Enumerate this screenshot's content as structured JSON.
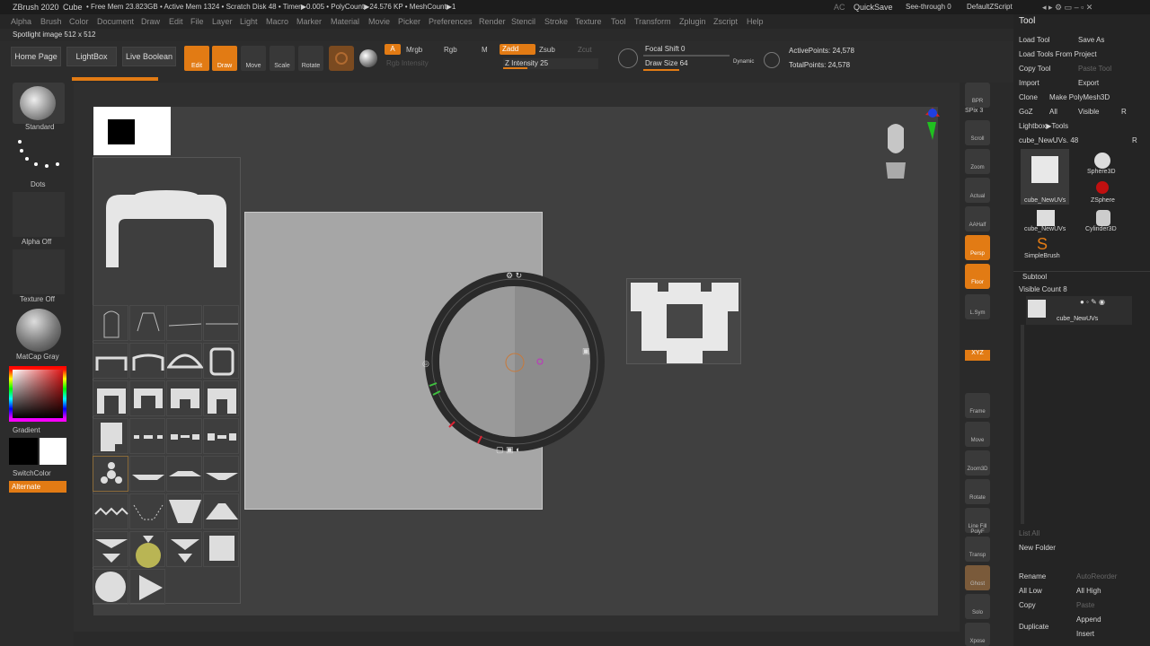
{
  "titlebar": {
    "app": "ZBrush 2020",
    "doc": "Cube",
    "stats": "• Free Mem 23.823GB • Active Mem 1324 • Scratch Disk 48 • Timer▶0.005 • PolyCount▶24.576 KP • MeshCount▶1",
    "ac": "AC",
    "quicksave": "QuickSave",
    "seethrough": "See-through 0",
    "script": "DefaultZScript"
  },
  "menu": [
    "Alpha",
    "Brush",
    "Color",
    "Document",
    "Draw",
    "Edit",
    "File",
    "Layer",
    "Light",
    "Macro",
    "Marker",
    "Material",
    "Movie",
    "Picker",
    "Preferences",
    "Render",
    "Stencil",
    "Stroke",
    "Texture",
    "Tool",
    "Transform",
    "Zplugin",
    "Zscript",
    "Help"
  ],
  "info": "Spotlight image 512 x 512",
  "shelf": {
    "home": "Home Page",
    "lightbox": "LightBox",
    "liveboolean": "Live Boolean",
    "edit": "Edit",
    "draw": "Draw",
    "move": "Move",
    "scale": "Scale",
    "rotate": "Rotate",
    "a": "A",
    "mrgb": "Mrgb",
    "rgb": "Rgb",
    "m": "M",
    "zadd": "Zadd",
    "zsub": "Zsub",
    "zcut": "Zcut",
    "rgbintensity": "Rgb Intensity",
    "zintensity": "Z Intensity 25",
    "focalshift": "Focal Shift 0",
    "drawsize": "Draw Size 64",
    "dynamic": "Dynamic",
    "activepoints": "ActivePoints: 24,578",
    "totalpoints": "TotalPoints: 24,578"
  },
  "left": {
    "standard": "Standard",
    "dots": "Dots",
    "alphaoff": "Alpha Off",
    "textureoff": "Texture Off",
    "matcap": "MatCap Gray",
    "gradient": "Gradient",
    "switchcolor": "SwitchColor",
    "alternate": "Alternate"
  },
  "rightshelf": [
    "BPR",
    "SPix 3",
    "Scroll",
    "Zoom",
    "Actual",
    "AAHalf",
    "Persp",
    "Floor",
    "L.Sym",
    "XYZ",
    "Frame",
    "Move",
    "Zoom3D",
    "Rotate",
    "Line Fill PolyF",
    "Transp",
    "Ghost",
    "Solo",
    "Xpose"
  ],
  "tool": {
    "title": "Tool",
    "loadtool": "Load Tool",
    "saveas": "Save As",
    "loadfromproject": "Load Tools From Project",
    "copytool": "Copy Tool",
    "pastetool": "Paste Tool",
    "import": "Import",
    "export": "Export",
    "clone": "Clone",
    "makepolymesh": "Make PolyMesh3D",
    "goz": "GoZ",
    "all": "All",
    "visible": "Visible",
    "r": "R",
    "lightboxtools": "Lightbox▶Tools",
    "current": "cube_NewUVs. 48",
    "items": [
      "cube_NewUVs",
      "Sphere3D",
      "ZSphere",
      "cube_NewUVs",
      "Cylinder3D",
      "SimpleBrush"
    ],
    "subtool": "Subtool",
    "visiblecount": "Visible Count 8",
    "subtoolname": "cube_NewUVs",
    "listall": "List All",
    "newfolder": "New Folder",
    "rename": "Rename",
    "autoreorder": "AutoReorder",
    "alllow": "All Low",
    "allhigh": "All High",
    "copy": "Copy",
    "paste": "Paste",
    "duplicate": "Duplicate",
    "append": "Append",
    "insert": "Insert"
  },
  "colors": {
    "orange": "#e27b14",
    "panel": "#2c2c2c",
    "canvas": "#404040"
  }
}
